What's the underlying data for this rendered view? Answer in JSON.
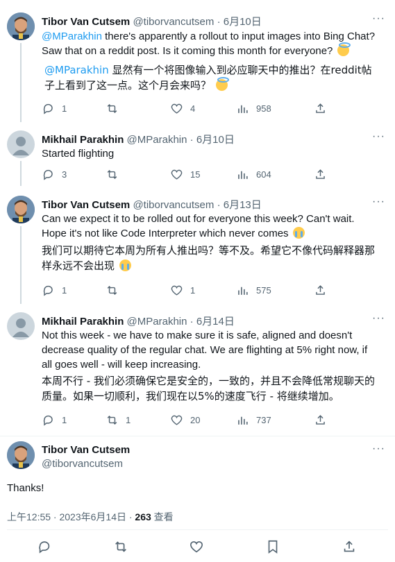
{
  "tweets": [
    {
      "name": "Tibor Van Cutsem",
      "handle": "@tiborvancutsem",
      "date": "6月10日",
      "mention": "@MParakhin",
      "text": " there's apparently a rollout to input images into Bing Chat? Saw that on a reddit post. Is it coming this month for everyone?",
      "translation_mention": "@MParakhin",
      "translation": " 显然有一个将图像输入到必应聊天中的推出？在reddit帖子上看到了这一点。这个月会来吗？",
      "replies": "1",
      "retweets": "",
      "likes": "4",
      "views": "958"
    },
    {
      "name": "Mikhail Parakhin",
      "handle": "@MParakhin",
      "date": "6月10日",
      "text": "Started flighting",
      "replies": "3",
      "retweets": "",
      "likes": "15",
      "views": "604"
    },
    {
      "name": "Tibor Van Cutsem",
      "handle": "@tiborvancutsem",
      "date": "6月13日",
      "text": "Can we expect it to be rolled out for everyone this week? Can't wait. Hope it's not like Code Interpreter which never comes",
      "translation": "我们可以期待它本周为所有人推出吗？等不及。希望它不像代码解释器那样永远不会出现",
      "replies": "1",
      "retweets": "",
      "likes": "1",
      "views": "575"
    },
    {
      "name": "Mikhail Parakhin",
      "handle": "@MParakhin",
      "date": "6月14日",
      "text": "Not this week - we have to make sure it is safe, aligned and doesn't decrease quality of the regular chat. We are flighting at 5% right now, if all goes well - will keep increasing.",
      "translation": "本周不行 - 我们必须确保它是安全的，一致的，并且不会降低常规聊天的质量。如果一切顺利，我们现在以5%的速度飞行 - 将继续增加。",
      "replies": "1",
      "retweets": "1",
      "likes": "20",
      "views": "737"
    }
  ],
  "main_tweet": {
    "name": "Tibor Van Cutsem",
    "handle": "@tiborvancutsem",
    "text": "Thanks!",
    "timestamp": "上午12:55 · 2023年6月14日 · ",
    "views_count": "263",
    "views_label": " 查看"
  },
  "more_label": "···",
  "colors": {
    "accent": "#1d9bf0",
    "muted": "#536471",
    "text": "#0f1419"
  },
  "icons": [
    "reply-icon",
    "retweet-icon",
    "like-icon",
    "views-icon",
    "share-icon",
    "bookmark-icon",
    "more-icon"
  ]
}
